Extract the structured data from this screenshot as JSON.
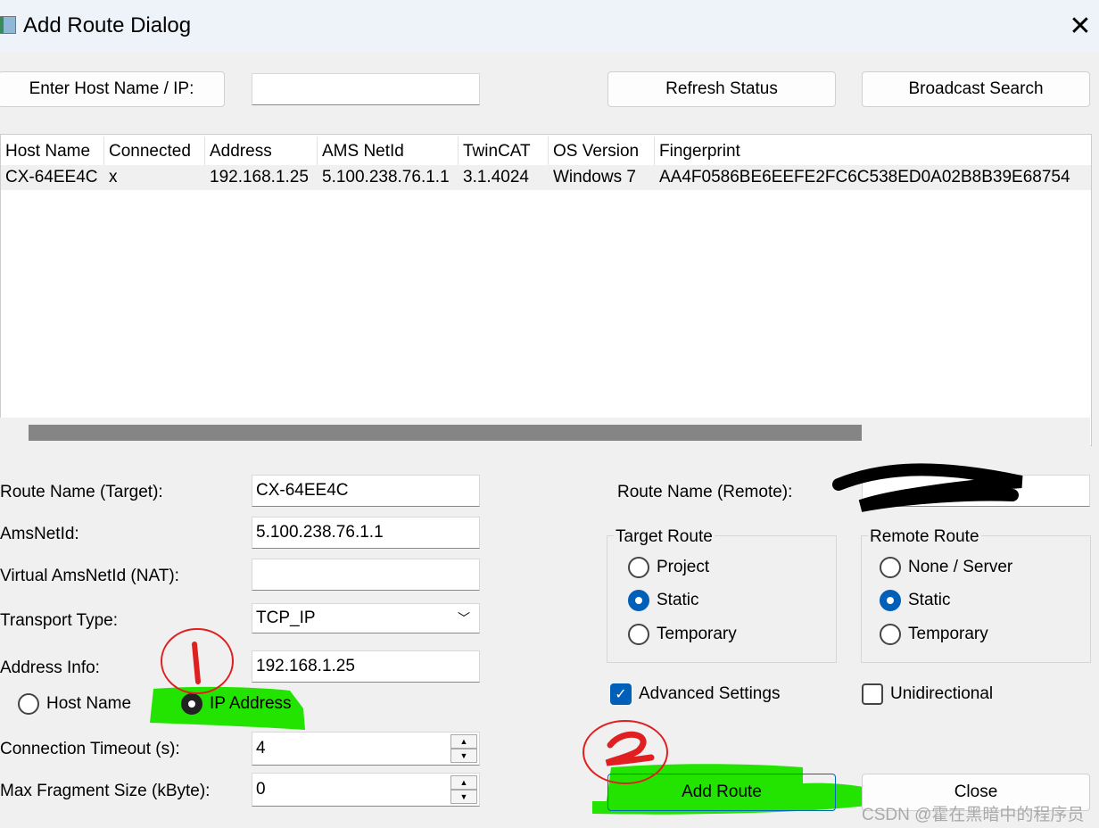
{
  "window": {
    "title": "Add Route Dialog",
    "close_icon": "close-icon"
  },
  "toolbar": {
    "enter_host_label": "Enter Host Name / IP:",
    "host_input_value": "",
    "refresh_label": "Refresh Status",
    "broadcast_label": "Broadcast Search"
  },
  "table": {
    "columns": [
      "Host Name",
      "Connected",
      "Address",
      "AMS NetId",
      "TwinCAT",
      "OS Version",
      "Fingerprint"
    ],
    "rows": [
      [
        "CX-64EE4C",
        "x",
        "192.168.1.25",
        "5.100.238.76.1.1",
        "3.1.4024",
        "Windows 7",
        "AA4F0586BE6EEFE2FC6C538ED0A02B8B39E68754"
      ]
    ]
  },
  "form": {
    "route_name_target_label": "Route Name (Target):",
    "route_name_target_value": "CX-64EE4C",
    "amsnetid_label": "AmsNetId:",
    "amsnetid_value": "5.100.238.76.1.1",
    "virtual_label": "Virtual AmsNetId (NAT):",
    "virtual_value": "",
    "transport_label": "Transport Type:",
    "transport_value": "TCP_IP",
    "address_info_label": "Address Info:",
    "address_info_value": "192.168.1.25",
    "host_name_option": "Host Name",
    "ip_address_option": "IP Address",
    "address_selected": "IP Address",
    "timeout_label": "Connection Timeout (s):",
    "timeout_value": "4",
    "fragment_label": "Max Fragment Size (kByte):",
    "fragment_value": "0"
  },
  "remote": {
    "route_name_remote_label": "Route Name (Remote):",
    "route_name_remote_value": "(redacted)"
  },
  "target_route": {
    "title": "Target Route",
    "options": [
      "Project",
      "Static",
      "Temporary"
    ],
    "selected": "Static"
  },
  "remote_route": {
    "title": "Remote Route",
    "options": [
      "None / Server",
      "Static",
      "Temporary"
    ],
    "selected": "Static"
  },
  "advanced_settings": {
    "label": "Advanced Settings",
    "checked": true
  },
  "unidirectional": {
    "label": "Unidirectional",
    "checked": false
  },
  "buttons": {
    "add_route": "Add Route",
    "close": "Close"
  },
  "annotations": {
    "mark1": "1",
    "mark2": "2",
    "highlight_color": "#22e400",
    "circle_color": "#e02020"
  },
  "watermark": "CSDN @霍在黑暗中的程序员"
}
